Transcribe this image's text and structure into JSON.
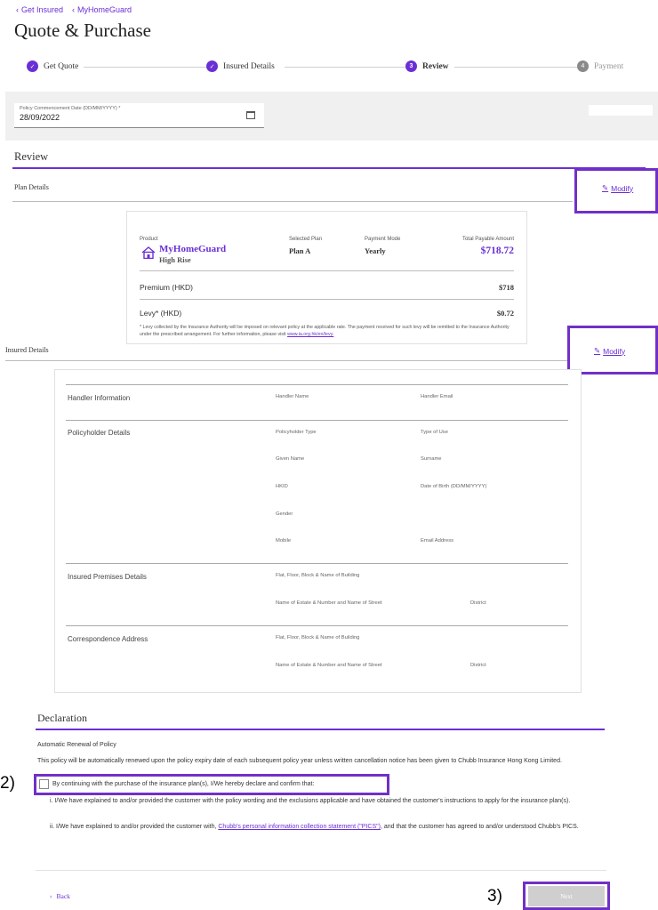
{
  "breadcrumb": {
    "items": [
      "Get Insured",
      "MyHomeGuard"
    ]
  },
  "page_title": "Quote & Purchase",
  "stepper": {
    "steps": [
      {
        "label": "Get Quote",
        "marker": "✓",
        "state": "done"
      },
      {
        "label": "Insured Details",
        "marker": "✓",
        "state": "done"
      },
      {
        "label": "Review",
        "marker": "3",
        "state": "current"
      },
      {
        "label": "Payment",
        "marker": "4",
        "state": "upcoming"
      }
    ]
  },
  "commencement": {
    "label": "Policy Commencement Date (DD/MM/YYYY) *",
    "value": "28/09/2022"
  },
  "review": {
    "heading": "Review",
    "plan_details_label": "Plan Details",
    "modify_label": "Modify",
    "plan_card": {
      "product_label": "Product",
      "product_name": "MyHomeGuard",
      "product_sub": "High Rise",
      "selected_plan_label": "Selected Plan",
      "selected_plan": "Plan A",
      "payment_mode_label": "Payment Mode",
      "payment_mode": "Yearly",
      "total_label": "Total Payable Amount",
      "total": "$718.72",
      "premium_label": "Premium (HKD)",
      "premium": "$718",
      "levy_label": "Levy* (HKD)",
      "levy": "$0.72",
      "levy_note": "* Levy collected by the Insurance Authority will be imposed on relevant policy at the applicable rate. The payment received for such levy will be remitted to the Insurance Authority under the prescribed arrangement. For further information, please visit ",
      "levy_link": "www.ia.org.hk/en/levy."
    },
    "insured_details_label": "Insured Details",
    "insured": {
      "handler_heading": "Handler Information",
      "handler_name": "Handler Name",
      "handler_email": "Handler Email",
      "policyholder_heading": "Policyholder Details",
      "policyholder_type": "Policyholder Type",
      "type_of_use": "Type of Use",
      "given_name": "Given Name",
      "surname": "Surname",
      "hkid": "HKID",
      "dob": "Date of Birth (DD/MM/YYYY)",
      "gender": "Gender",
      "mobile": "Mobile",
      "email": "Email Address",
      "premises_heading": "Insured Premises Details",
      "premises_flat": "Flat, Floor, Block & Name of Building",
      "premises_estate": "Name of Estate & Number and Name of Street",
      "premises_district": "District",
      "corr_heading": "Correspondence Address",
      "corr_flat": "Flat, Floor, Block & Name of Building",
      "corr_estate": "Name of Estate & Number and Name of Street",
      "corr_district": "District"
    }
  },
  "declaration": {
    "heading": "Declaration",
    "renewal_heading": "Automatic Renewal of Policy",
    "renewal_text": "This policy will be automatically renewed upon the policy expiry date of each subsequent policy year unless written cancellation notice has been given to Chubb Insurance Hong Kong Limited.",
    "confirm_label": "By continuing with the purchase of the insurance plan(s), I/We hereby declare and confirm that:",
    "item1": "i. I/We have explained to and/or provided the customer with the policy wording and the exclusions applicable and have obtained the customer's instructions to apply for the insurance plan(s).",
    "item2_pre": "ii. I/We have explained to and/or provided the customer with, ",
    "item2_link": "Chubb's personal information collection statement (\"PICS\")",
    "item2_post": ", and that the customer has agreed to and/or understood Chubb's PICS."
  },
  "footer": {
    "back_label": "Back",
    "next_label": "Next"
  },
  "annotations": {
    "two": "2)",
    "three": "3)"
  },
  "colors": {
    "accent": "#6b2fd6",
    "highlight": "#7030c8"
  }
}
